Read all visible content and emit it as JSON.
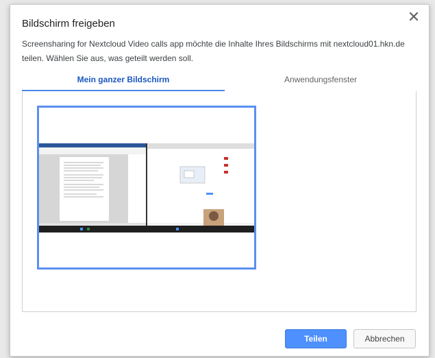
{
  "dialog": {
    "title": "Bildschirm freigeben",
    "description": "Screensharing for Nextcloud Video calls app möchte die Inhalte Ihres Bildschirms mit nextcloud01.hkn.de teilen. Wählen Sie aus, was geteilt werden soll.",
    "close_icon": "close-icon"
  },
  "tabs": [
    {
      "label": "Mein ganzer Bildschirm",
      "active": true
    },
    {
      "label": "Anwendungsfenster",
      "active": false
    }
  ],
  "buttons": {
    "share_label": "Teilen",
    "cancel_label": "Abbrechen"
  },
  "colors": {
    "accent": "#4a86e8",
    "active_tab_text": "#1a56c0",
    "share_button": "#4d90fe"
  }
}
